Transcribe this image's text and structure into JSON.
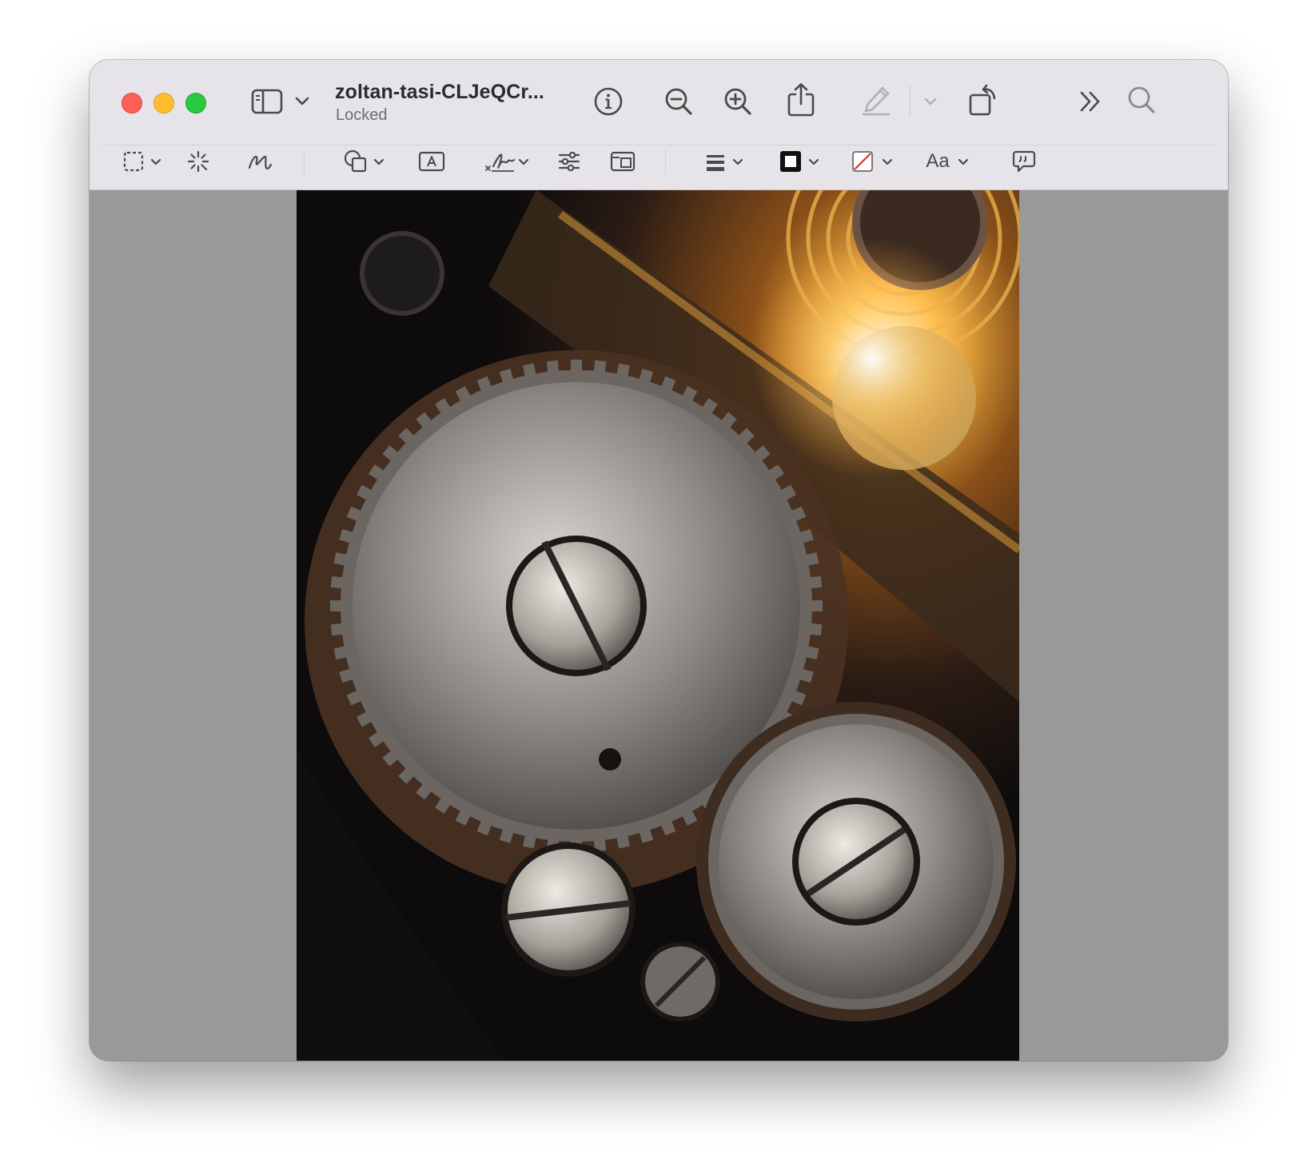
{
  "window": {
    "title": "zoltan-tasi-CLJeQCr...",
    "subtitle": "Locked"
  },
  "toolbar": {
    "text_style_label": "Aa",
    "icons": [
      "sidebar-icon",
      "chevron-down-icon",
      "info-icon",
      "zoom-out-icon",
      "zoom-in-icon",
      "share-icon",
      "markup-pen-icon",
      "rotate-icon",
      "more-icon",
      "search-icon",
      "rect-selection-icon",
      "instant-alpha-icon",
      "sketch-icon",
      "shapes-icon",
      "text-box-icon",
      "signature-icon",
      "adjust-color-icon",
      "adjust-size-icon",
      "shape-style-icon",
      "border-color-icon",
      "fill-color-icon",
      "text-style-icon",
      "speech-bubble-icon"
    ]
  },
  "document": {
    "image_subject": "close-up of clockwork gears"
  },
  "colors": {
    "toolbar_bg": "#e6e4e8",
    "canvas_bg": "#999999",
    "traffic_red": "#fe5f57",
    "traffic_yellow": "#febc2e",
    "traffic_green": "#28c840"
  }
}
